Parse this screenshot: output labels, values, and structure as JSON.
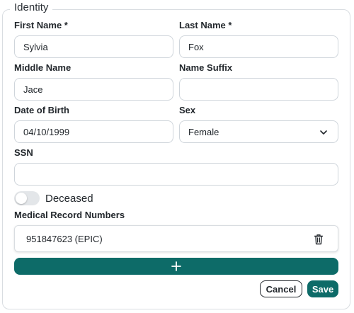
{
  "section": {
    "title": "Identity"
  },
  "fields": {
    "first_name": {
      "label": "First Name *",
      "value": "Sylvia"
    },
    "last_name": {
      "label": "Last Name *",
      "value": "Fox"
    },
    "middle_name": {
      "label": "Middle Name",
      "value": "Jace"
    },
    "name_suffix": {
      "label": "Name Suffix",
      "value": ""
    },
    "dob": {
      "label": "Date of Birth",
      "value": "04/10/1999"
    },
    "sex": {
      "label": "Sex",
      "value": "Female"
    },
    "ssn": {
      "label": "SSN",
      "value": ""
    }
  },
  "deceased": {
    "label": "Deceased",
    "checked": false
  },
  "mrn": {
    "label": "Medical Record Numbers",
    "items": [
      {
        "text": "951847623 (EPIC)"
      }
    ]
  },
  "actions": {
    "cancel": "Cancel",
    "save": "Save"
  },
  "colors": {
    "primary": "#0d6b68",
    "border": "#cfd5db"
  },
  "icons": {
    "add": "plus-icon",
    "delete": "trash-icon",
    "dropdown": "chevron-down-icon"
  }
}
